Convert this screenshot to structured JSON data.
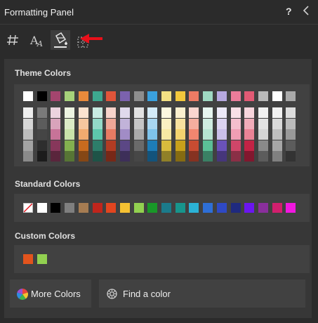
{
  "header": {
    "title": "Formatting Panel",
    "help_label": "?"
  },
  "tabs": [
    {
      "name": "number-format",
      "icon": "hash-icon"
    },
    {
      "name": "font",
      "icon": "font-size-icon"
    },
    {
      "name": "fill",
      "icon": "paint-bucket-icon",
      "active": true
    },
    {
      "name": "border",
      "icon": "border-icon"
    }
  ],
  "annotation": {
    "color": "#e8101a",
    "icon": "red-arrow-pointer"
  },
  "theme": {
    "label": "Theme Colors",
    "base": [
      "#ffffff",
      "#000000",
      "#a3456e",
      "#a6d27a",
      "#e98a3b",
      "#3da88f",
      "#e0553a",
      "#7b62ae",
      "#8e8e8e",
      "#3aa1de",
      "#f4e184",
      "#f2c73c",
      "#ed7b64",
      "#9fd9c2",
      "#b7a9e0",
      "#ea7c9a",
      "#e25a74",
      "#b9b9b9",
      "#ffffff",
      "#a9a9a9"
    ],
    "shades": [
      [
        "#eeeeee",
        "#d6d6d6",
        "#bdbdbd",
        "#a3a3a3",
        "#8a8a8a"
      ],
      [
        "#7a7a7a",
        "#5c5c5c",
        "#454545",
        "#2e2e2e",
        "#1c1c1c"
      ],
      [
        "#ecd3de",
        "#d9a3bb",
        "#c77398",
        "#87375b",
        "#5a253c"
      ],
      [
        "#edf5e2",
        "#dbebc6",
        "#c9e2a9",
        "#83b04f",
        "#577535"
      ],
      [
        "#fbe3cf",
        "#f6c79f",
        "#f1ab6f",
        "#c86b1f",
        "#854715"
      ],
      [
        "#c9ece3",
        "#93d9c7",
        "#5dc6ab",
        "#2d7d6a",
        "#1e5347"
      ],
      [
        "#f7d3cb",
        "#efa797",
        "#e77b63",
        "#b23c23",
        "#772817"
      ],
      [
        "#e0d9ec",
        "#c1b3d9",
        "#a18cc6",
        "#5b4785",
        "#3d2f59"
      ],
      [
        "#e2e2e2",
        "#c6c6c6",
        "#aaaaaa",
        "#6a6a6a",
        "#474747"
      ],
      [
        "#d4ebf8",
        "#a9d7f1",
        "#7ec3ea",
        "#1d7db8",
        "#13537b"
      ],
      [
        "#fcf8e0",
        "#faf0c2",
        "#f7e9a3",
        "#d8bb3d",
        "#908028"
      ],
      [
        "#fbf0cf",
        "#f8e29f",
        "#f4d46f",
        "#c7a01b",
        "#856b12"
      ],
      [
        "#fad6cf",
        "#f5ae9f",
        "#f1866f",
        "#c84c32",
        "#853221"
      ],
      [
        "#e7f6f0",
        "#cfede1",
        "#b7e4d2",
        "#5bbf97",
        "#3a8064"
      ],
      [
        "#ede9f8",
        "#dcd4f1",
        "#cabfea",
        "#6a52b9",
        "#46367b"
      ],
      [
        "#fadfe6",
        "#f5becd",
        "#f09eb4",
        "#cf4669",
        "#8a2f46"
      ],
      [
        "#f8d5dc",
        "#f1acb9",
        "#eb8396",
        "#c22345",
        "#81172e"
      ],
      [
        "#f1f1f1",
        "#e3e3e3",
        "#d5d5d5",
        "#8a8a8a",
        "#5c5c5c"
      ],
      [
        "#f2f2f2",
        "#d9d9d9",
        "#bfbfbf",
        "#a6a6a6",
        "#808080"
      ],
      [
        "#dddddd",
        "#bbbbbb",
        "#999999",
        "#5c5c5c",
        "#333333"
      ]
    ]
  },
  "standard": {
    "label": "Standard Colors",
    "colors": [
      "none",
      "#ffffff",
      "#000000",
      "#7f7f7f",
      "#a67c52",
      "#c0251c",
      "#e2451f",
      "#f5c132",
      "#92d050",
      "#199828",
      "#1b7b8b",
      "#17958c",
      "#2bb2d6",
      "#2e6fd7",
      "#2f49c4",
      "#1f2a7f",
      "#6b16f0",
      "#8a2f9c",
      "#d21f6e",
      "#f117e0"
    ]
  },
  "custom": {
    "label": "Custom Colors",
    "colors": [
      "#e2541d",
      "#92d050"
    ]
  },
  "buttons": {
    "more_colors": "More Colors",
    "find_color": "Find a color"
  }
}
